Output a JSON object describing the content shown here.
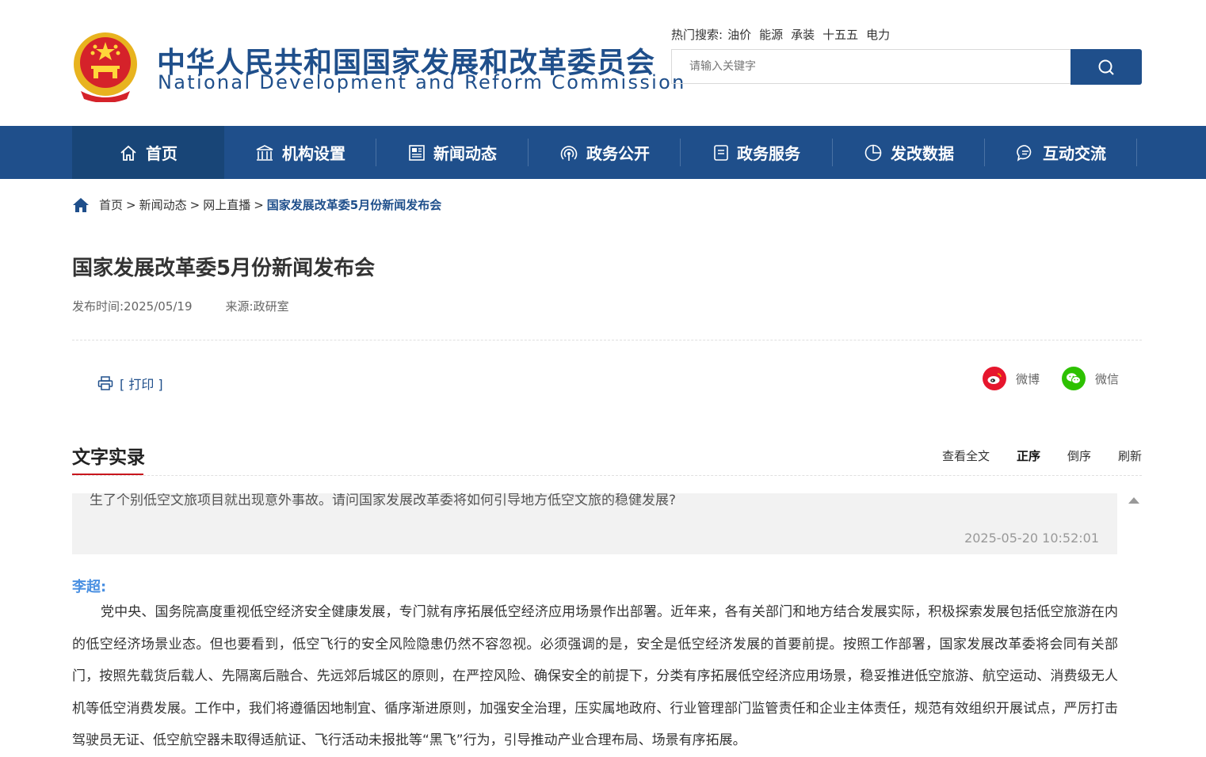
{
  "header": {
    "site_title_cn": "中华人民共和国国家发展和改革委员会",
    "site_title_en": "National Development and Reform Commission",
    "hot_label": "热门搜索:",
    "hot_keywords": [
      "油价",
      "能源",
      "承装",
      "十五五",
      "电力"
    ],
    "search_placeholder": "请输入关键字"
  },
  "nav": {
    "items": [
      {
        "label": "首页",
        "icon": "home-icon"
      },
      {
        "label": "机构设置",
        "icon": "building-icon"
      },
      {
        "label": "新闻动态",
        "icon": "news-icon"
      },
      {
        "label": "政务公开",
        "icon": "broadcast-icon"
      },
      {
        "label": "政务服务",
        "icon": "document-icon"
      },
      {
        "label": "发改数据",
        "icon": "pie-chart-icon"
      },
      {
        "label": "互动交流",
        "icon": "chat-icon"
      }
    ]
  },
  "breadcrumb": {
    "items": [
      "首页",
      "新闻动态",
      "网上直播"
    ],
    "current": "国家发展改革委5月份新闻发布会",
    "separator": ">"
  },
  "article": {
    "title": "国家发展改革委5月份新闻发布会",
    "publish_time": "发布时间:2025/05/19",
    "source": "来源:政研室"
  },
  "actions": {
    "print_label": "[ 打印 ]",
    "weibo_label": "微博",
    "wechat_label": "微信"
  },
  "transcript": {
    "section_title": "文字实录",
    "tools": [
      "查看全文",
      "正序",
      "倒序",
      "刷新"
    ],
    "active_tool": "正序",
    "question_text": "生了个别低空文旅项目就出现意外事故。请问国家发展改革委将如何引导地方低空文旅的稳健发展?",
    "question_time": "2025-05-20 10:52:01",
    "speaker": "李超:",
    "answer": "党中央、国务院高度重视低空经济安全健康发展，专门就有序拓展低空经济应用场景作出部署。近年来，各有关部门和地方结合发展实际，积极探索发展包括低空旅游在内的低空经济场景业态。但也要看到，低空飞行的安全风险隐患仍然不容忽视。必须强调的是，安全是低空经济发展的首要前提。按照工作部署，国家发展改革委将会同有关部门，按照先载货后载人、先隔离后融合、先远郊后城区的原则，在严控风险、确保安全的前提下，分类有序拓展低空经济应用场景，稳妥推进低空旅游、航空运动、消费级无人机等低空消费发展。工作中，我们将遵循因地制宜、循序渐进原则，加强安全治理，压实属地政府、行业管理部门监管责任和企业主体责任，规范有效组织开展试点，严厉打击驾驶员无证、低空航空器未取得适航证、飞行活动未报批等“黑飞”行为，引导推动产业合理布局、场景有序拓展。"
  },
  "colors": {
    "brand_blue": "#1f4f8b",
    "nav_active": "#184577",
    "accent_red": "#c8161d",
    "speaker_blue": "#4a90e2",
    "weibo_red": "#e6162d",
    "wechat_green": "#2dc100"
  }
}
